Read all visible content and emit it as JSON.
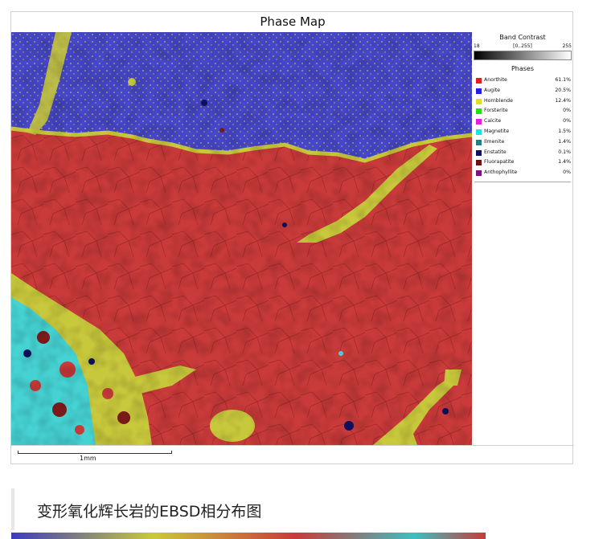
{
  "figure": {
    "title": "Phase Map",
    "band_contrast": {
      "title": "Band Contrast",
      "min": "18",
      "range": "[0..255]",
      "max": "255"
    },
    "phases_title": "Phases",
    "phases": [
      {
        "name": "Anorthite",
        "percent": "61.1%",
        "color": "#e02020"
      },
      {
        "name": "Augite",
        "percent": "20.5%",
        "color": "#2020e0"
      },
      {
        "name": "Hornblende",
        "percent": "12.4%",
        "color": "#e0e020"
      },
      {
        "name": "Forsterite",
        "percent": "0%",
        "color": "#20e020"
      },
      {
        "name": "Calcite",
        "percent": "0%",
        "color": "#e020e0"
      },
      {
        "name": "Magnetite",
        "percent": "1.5%",
        "color": "#20e0e0"
      },
      {
        "name": "Ilmenite",
        "percent": "1.4%",
        "color": "#208080"
      },
      {
        "name": "Enstatite",
        "percent": "0.1%",
        "color": "#101060"
      },
      {
        "name": "Fluorapatite",
        "percent": "1.4%",
        "color": "#701010"
      },
      {
        "name": "Anthophyllite",
        "percent": "0%",
        "color": "#801080"
      }
    ],
    "scale_label": "1mm"
  },
  "caption": "变形氧化辉长岩的EBSD相分布图",
  "colors": {
    "anorthite": "#c93a3a",
    "augite": "#4646c8",
    "hornblende": "#c8c83c",
    "magnetite": "#46d2d2"
  }
}
